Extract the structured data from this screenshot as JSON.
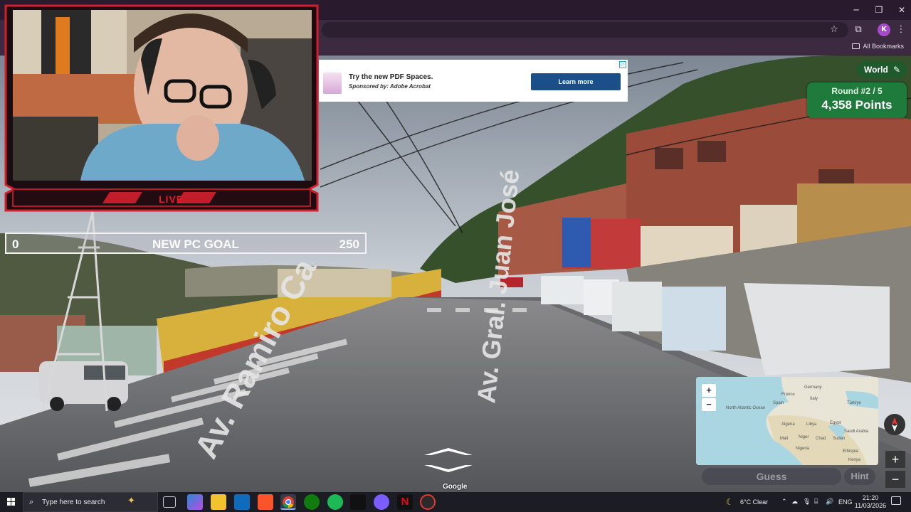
{
  "browser": {
    "window_controls": {
      "minimize": "─",
      "restore": "❐",
      "close": "✕"
    },
    "profile_initial": "K",
    "bookmarks_label": "All Bookmarks",
    "icons": [
      "star-icon",
      "extensions-icon",
      "menu-icon",
      "folder-icon"
    ]
  },
  "ad": {
    "title": "Try the new PDF Spaces.",
    "sponsor": "Sponsored by: Adobe Acrobat",
    "button": "Learn more"
  },
  "stream": {
    "live_label": "LIVE",
    "goal": {
      "start": "0",
      "label": "NEW PC GOAL",
      "end": "250"
    }
  },
  "street": {
    "sign_left": "Av. Ramiro Ca",
    "sign_center": "Av. Gral. Juan José",
    "google": "Google"
  },
  "game": {
    "map_mode": "World",
    "round": "Round #2 / 5",
    "points": "4,358 Points",
    "guess_button": "Guess",
    "hint_button": "Hint",
    "zoom_in": "+",
    "zoom_out": "−",
    "sv_zoom_in": "+",
    "sv_zoom_out": "−",
    "map_labels": [
      "Germany",
      "France",
      "Italy",
      "Spain",
      "Türkiye",
      "North Atlantic Ocean",
      "Algeria",
      "Libya",
      "Egypt",
      "Saudi Arabia",
      "Mali",
      "Niger",
      "Chad",
      "Sudan",
      "Nigeria",
      "Ethiopia",
      "Kenya"
    ]
  },
  "taskbar": {
    "search_placeholder": "Type here to search",
    "weather": "6°C  Clear",
    "language": "ENG",
    "time": "21:20",
    "date": "11/03/2026",
    "colors": {
      "chrome": "#3b2a40",
      "score_green": "#1f7b3b",
      "live_red": "#e31b2f"
    }
  }
}
